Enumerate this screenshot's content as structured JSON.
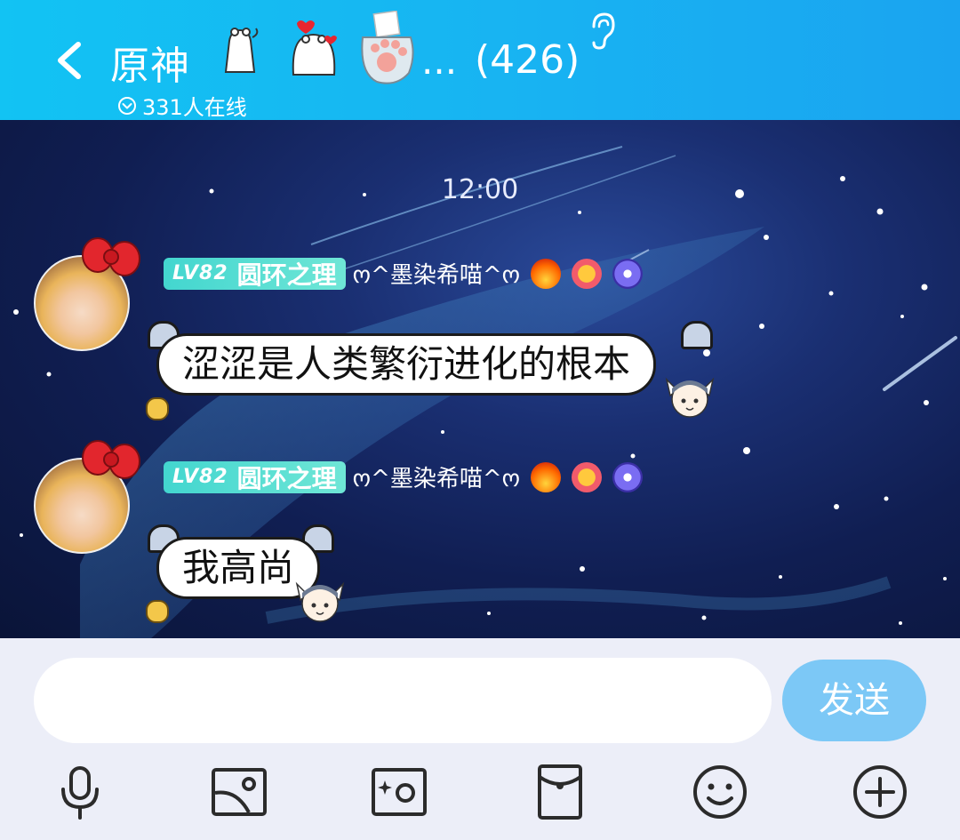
{
  "header": {
    "title": "原神",
    "ellipsis": "...",
    "member_count": "(426)",
    "online_status": "331人在线",
    "icons": [
      "back-arrow-icon",
      "bear-sticker-icon",
      "heart-bear-sticker-icon",
      "cat-paw-sticker-icon",
      "ear-icon",
      "online-chevron-icon"
    ]
  },
  "chat": {
    "timestamp": "12:00",
    "messages": [
      {
        "level": "LV82",
        "title": "圆环之理",
        "nickname": "ო^墨染希喵^ო",
        "text": "涩涩是人类繁衍进化的根本"
      },
      {
        "level": "LV82",
        "title": "圆环之理",
        "nickname": "ო^墨染希喵^ო",
        "text": "我高尚"
      }
    ]
  },
  "composer": {
    "input_value": "",
    "send_label": "发送"
  },
  "toolbar": [
    "microphone-icon",
    "image-icon",
    "camera-icon",
    "red-packet-icon",
    "emoji-icon",
    "plus-icon"
  ],
  "colors": {
    "header_accent": "#15b8f2",
    "send_button": "#7cc8f6",
    "level_badge": "#4fdbd2"
  }
}
